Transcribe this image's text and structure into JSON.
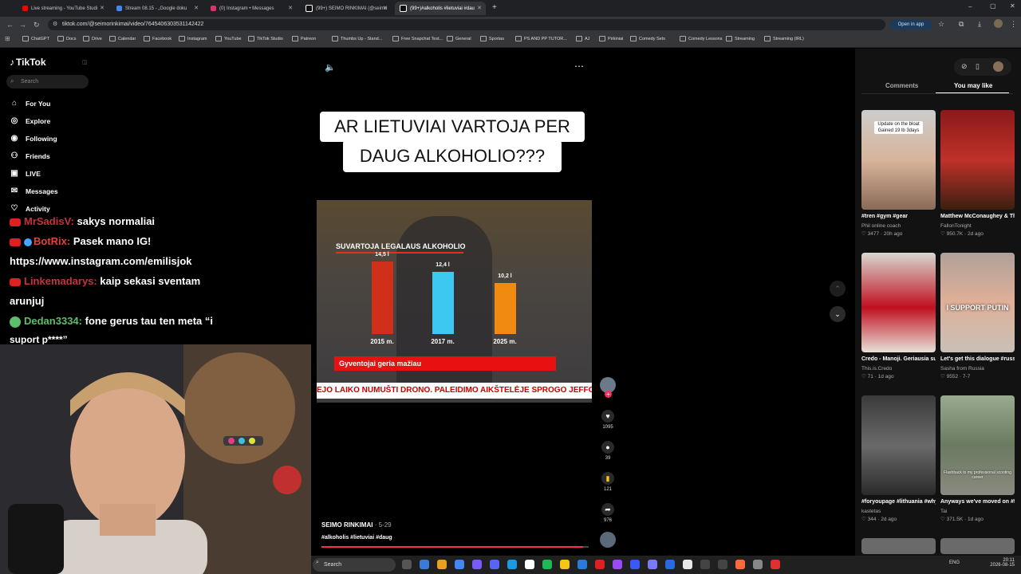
{
  "tabs": [
    {
      "label": "Live streaming - YouTube Studi",
      "color": "#ff0000"
    },
    {
      "label": "Stream 08.15 - „Google doku",
      "color": "#4285f4"
    },
    {
      "label": "(0) Instagram • Messages",
      "color": "#e1306c"
    },
    {
      "label": "(99+) SEIMO RINKIMAI (@seimo",
      "color": "#ffffff"
    },
    {
      "label": "(99+)#alkoholis #lietuviai #dau",
      "color": "#ffffff"
    }
  ],
  "url": "tiktok.com/@seimorinkimai/video/7645406303531142422",
  "open_in_app": "Open in app",
  "bookmarks": [
    "ChatGPT",
    "Docs",
    "Drive",
    "Calendar",
    "Facebook",
    "Instagram",
    "YouTube",
    "TikTok Studio",
    "Patreon",
    "Thumbs Up - Stand...",
    "Free Snapchat Test...",
    "General",
    "Sportas",
    "PS AND PP TUTOR...",
    "AJ",
    "Pirkiniai",
    "Comedy Sets",
    "Comedy Lessons",
    "Streaming",
    "Streaming (IRL)"
  ],
  "sidebar": {
    "logo": "TikTok",
    "search_placeholder": "Search",
    "items": [
      "For You",
      "Explore",
      "Following",
      "Friends",
      "LIVE",
      "Messages",
      "Activity"
    ]
  },
  "chat": [
    {
      "user": "MrSadisV:",
      "user_color": "#c8323c",
      "text": "sakys normaliai"
    },
    {
      "user": "BotRix:",
      "user_color": "#e0453c",
      "text": "Pasek mano IG!"
    },
    {
      "user": "",
      "user_color": "#ffffff",
      "text": "https://www.instagram.com/emilisjok"
    },
    {
      "user": "Linkemadarys:",
      "user_color": "#c8323c",
      "text": "kaip sekasi sventam"
    },
    {
      "user": "",
      "user_color": "#ffffff",
      "text": "arunjuj"
    },
    {
      "user": "Dedan3334:",
      "user_color": "#5cbf6a",
      "text": "fone gerus tau ten meta “i"
    },
    {
      "user": "",
      "user_color": "#ffffff",
      "text": "suport p****”"
    }
  ],
  "video": {
    "title_line1": "AR LIETUVIAI VARTOJA PER",
    "title_line2": "DAUG ALKOHOLIO???",
    "chart_heading": "SUVARTOJA LEGALAUS ALKOHOLIO",
    "banner": "Gyventojai geria mažiau",
    "ticker": "EJO LAIKO NUMUŠTI DRONO.  PALEIDIMO AIKŠTELĖJE SPROGO JEFFO",
    "author": "SEIMO RINKIMAI",
    "date": "5-29",
    "hashtags": "#alkoholis #lietuviai #daug"
  },
  "chart_data": {
    "type": "bar",
    "title": "SUVARTOJA LEGALAUS ALKOHOLIO",
    "categories": [
      "2015 m.",
      "2017 m.",
      "2025 m."
    ],
    "values": [
      14.5,
      12.4,
      10.2
    ],
    "value_labels": [
      "14,5 l",
      "12,4 l",
      "10,2 l"
    ],
    "colors": [
      "#d0301a",
      "#3cc8f0",
      "#f08a10"
    ]
  },
  "actions": {
    "likes": "1095",
    "comments": "39",
    "saves": "121",
    "shares": "976"
  },
  "right_panel": {
    "tab_comments": "Comments",
    "tab_you_may_like": "You may like",
    "cards": [
      {
        "overlay": "Update on the bloat Gained 19 lb 3days",
        "title": "#tren #gym #gear",
        "author": "Phil online coach",
        "stats": "3477 · 20h ago"
      },
      {
        "overlay": "",
        "title": "Matthew McConaughey & The Last Bison...",
        "author": "FallonTonight",
        "stats": "950.7K · 2d ago"
      },
      {
        "overlay": "",
        "title": "Credo - Manoji. Geriausia sukurta dain...",
        "author": "This.is.Credo",
        "stats": "71 · 1d ago"
      },
      {
        "overlay": "I SUPPORT PUTIN",
        "title": "Let's get this dialogue #russia #russian",
        "author": "Sasha from Russia",
        "stats": "9552 · 7-7"
      },
      {
        "overlay": "",
        "title": "#foryoupage #lithuania #whydotas",
        "author": "kastetas",
        "stats": "344 · 2d ago"
      },
      {
        "overlay": "Flashback to my professional scooting career",
        "title": "Anyways we've moved on #fyp #fypシ...",
        "author": "Tai",
        "stats": "371.5K · 1d ago"
      }
    ]
  },
  "taskbar": {
    "search": "Search",
    "lang": "ENG",
    "time": "20:11",
    "date": "2026-08-15"
  }
}
